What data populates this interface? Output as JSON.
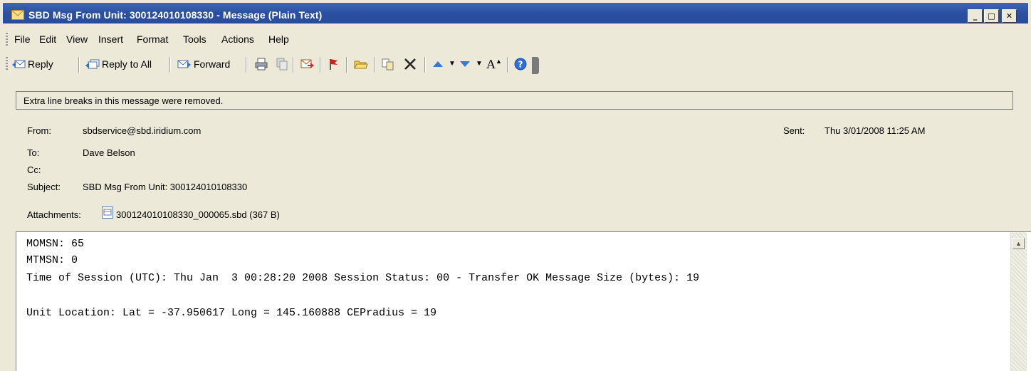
{
  "window": {
    "title": "SBD Msg From Unit: 300124010108330 - Message (Plain Text)",
    "minimize": "_",
    "maximize": "□",
    "close": "✕"
  },
  "menu": {
    "items": [
      {
        "label": "File"
      },
      {
        "label": "Edit"
      },
      {
        "label": "View"
      },
      {
        "label": "Insert"
      },
      {
        "label": "Format"
      },
      {
        "label": "Tools"
      },
      {
        "label": "Actions"
      },
      {
        "label": "Help"
      }
    ]
  },
  "toolbar": {
    "reply": "Reply",
    "reply_all": "Reply to All",
    "forward": "Forward",
    "font_size_glyph": "A"
  },
  "infobar": {
    "text": "Extra line breaks in this message were removed."
  },
  "header": {
    "from_label": "From:",
    "from_value": "sbdservice@sbd.iridium.com",
    "sent_label": "Sent:",
    "sent_value": "Thu 3/01/2008 11:25 AM",
    "to_label": "To:",
    "to_value": "Dave Belson",
    "cc_label": "Cc:",
    "cc_value": "",
    "subject_label": "Subject:",
    "subject_value": "SBD Msg From Unit: 300124010108330",
    "attachments_label": "Attachments:",
    "attachment_name": "300124010108330_000065.sbd (367 B)"
  },
  "body": {
    "lines": [
      "MOMSN: 65",
      "MTMSN: 0",
      "Time of Session (UTC): Thu Jan  3 00:28:20 2008 Session Status: 00 - Transfer OK Message Size (bytes): 19",
      "",
      "Unit Location: Lat = -37.950617 Long = 145.160888 CEPradius = 19"
    ]
  },
  "colors": {
    "title_bar": "#2b4fa0",
    "chrome": "#ece9d8",
    "body_bg": "#ffffff"
  }
}
